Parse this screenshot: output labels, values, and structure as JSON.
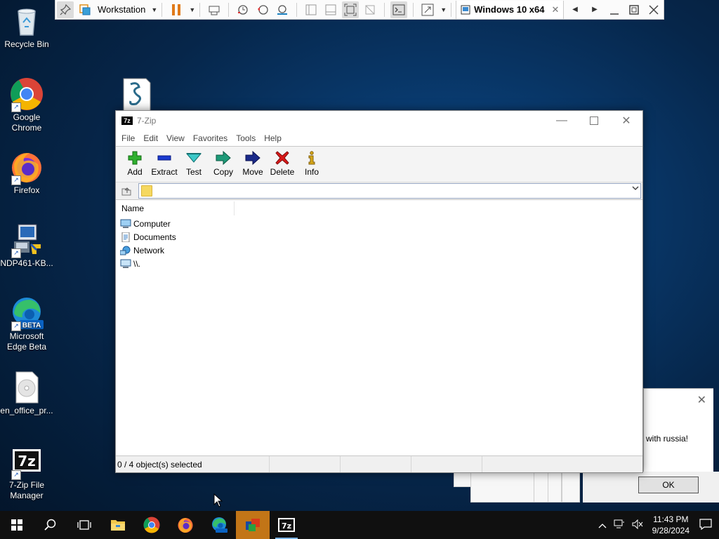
{
  "vm_toolbar": {
    "library_label": "Workstation",
    "vm_tab": "Windows 10 x64",
    "icons": [
      "pin-icon",
      "library-icon",
      "pause-icon",
      "send-keys-icon",
      "snapshot-icon",
      "revert-snapshot-icon",
      "snapshot-manager-icon",
      "sidebar-icon",
      "thumbnail-icon",
      "fullscreen-icon",
      "unity-icon",
      "console-icon",
      "stretch-icon"
    ]
  },
  "desktop": {
    "icons": [
      {
        "label": "Recycle Bin",
        "icon": "recycle-bin-icon"
      },
      {
        "label": "Google Chrome",
        "icon": "chrome-icon"
      },
      {
        "label": "Firefox",
        "icon": "firefox-icon"
      },
      {
        "label": "NDP461-KB...",
        "icon": "installer-icon"
      },
      {
        "label": "Microsoft Edge Beta",
        "icon": "edge-beta-icon"
      },
      {
        "label": "en_office_pr...",
        "icon": "disc-image-icon"
      },
      {
        "label": "7-Zip File Manager",
        "icon": "7zip-icon"
      }
    ]
  },
  "zip_window": {
    "app_icon_text": "7z",
    "title": "7-Zip",
    "menu": [
      "File",
      "Edit",
      "View",
      "Favorites",
      "Tools",
      "Help"
    ],
    "toolbar": [
      {
        "label": "Add",
        "icon": "add-icon",
        "color": "#22a322"
      },
      {
        "label": "Extract",
        "icon": "extract-icon",
        "color": "#1a2fb8"
      },
      {
        "label": "Test",
        "icon": "test-icon",
        "color": "#1fa8a8"
      },
      {
        "label": "Copy",
        "icon": "copy-icon",
        "color": "#1a8a6a"
      },
      {
        "label": "Move",
        "icon": "move-icon",
        "color": "#1a2a8a"
      },
      {
        "label": "Delete",
        "icon": "delete-icon",
        "color": "#d11a1a"
      },
      {
        "label": "Info",
        "icon": "info-icon",
        "color": "#c8a010"
      }
    ],
    "address_value": "",
    "column_name": "Name",
    "items": [
      {
        "name": "Computer",
        "icon": "computer-icon"
      },
      {
        "name": "Documents",
        "icon": "documents-icon"
      },
      {
        "name": "Network",
        "icon": "network-icon"
      },
      {
        "name": "\\\\.",
        "icon": "device-icon"
      }
    ],
    "status": "0 / 4 object(s) selected"
  },
  "dialog": {
    "message": "with russia!",
    "ok_label": "OK"
  },
  "taskbar": {
    "apps": [
      "start-icon",
      "search-icon",
      "task-view-icon",
      "file-explorer-icon",
      "chrome-icon",
      "firefox-icon",
      "edge-beta-icon",
      "installer-app-icon",
      "7zip-icon"
    ],
    "time": "11:43 PM",
    "date": "9/28/2024"
  },
  "colors": {
    "accent_taskbar_active": "#c27517",
    "desktop_bg": "#093a6e"
  }
}
